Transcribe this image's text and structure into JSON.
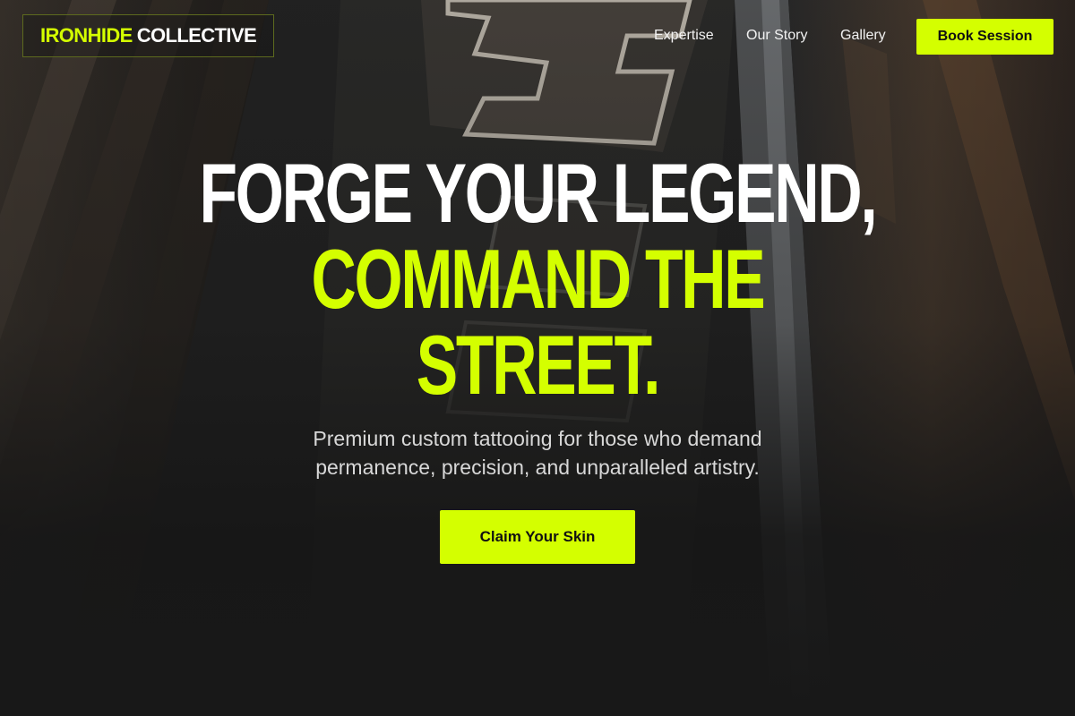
{
  "header": {
    "logo_primary": "IRONHIDE",
    "logo_secondary": "COLLECTIVE",
    "nav": [
      {
        "label": "Expertise"
      },
      {
        "label": "Our Story"
      },
      {
        "label": "Gallery"
      }
    ],
    "cta_label": "Book Session"
  },
  "hero": {
    "headline_line1": "FORGE YOUR LEGEND,",
    "headline_line2": "COMMAND THE",
    "headline_line3": "STREET.",
    "subtitle": "Premium custom tattooing for those who demand permanence, precision, and unparalleled artistry.",
    "cta_label": "Claim Your Skin"
  },
  "colors": {
    "accent": "#d4ff00",
    "background": "#181818",
    "text": "#ffffff"
  },
  "icons": {
    "background": "neon-sign-photo"
  }
}
